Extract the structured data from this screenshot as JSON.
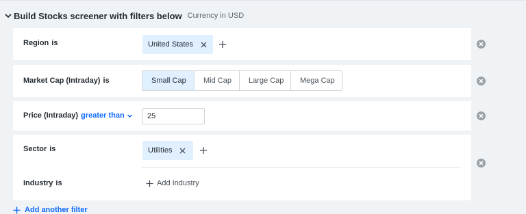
{
  "header": {
    "title": "Build Stocks screener with filters below",
    "subtitle": "Currency in USD"
  },
  "filters": {
    "region": {
      "label": "Region",
      "operator": "is",
      "chips": [
        "United States"
      ]
    },
    "market_cap": {
      "label": "Market Cap (Intraday)",
      "operator": "is",
      "options": [
        "Small Cap",
        "Mid Cap",
        "Large Cap",
        "Mega Cap"
      ],
      "selected": "Small Cap"
    },
    "price": {
      "label": "Price (Intraday)",
      "operator": "greater than",
      "value": "25"
    },
    "sector": {
      "label": "Sector",
      "operator": "is",
      "chips": [
        "Utilities"
      ]
    },
    "industry": {
      "label": "Industry",
      "operator": "is",
      "add_label": "Add Industry"
    }
  },
  "add_filter_label": "Add another filter",
  "colors": {
    "accent": "#0f69ff",
    "chip_bg": "#e0f0ff",
    "page_bg": "#f0f3f5"
  }
}
